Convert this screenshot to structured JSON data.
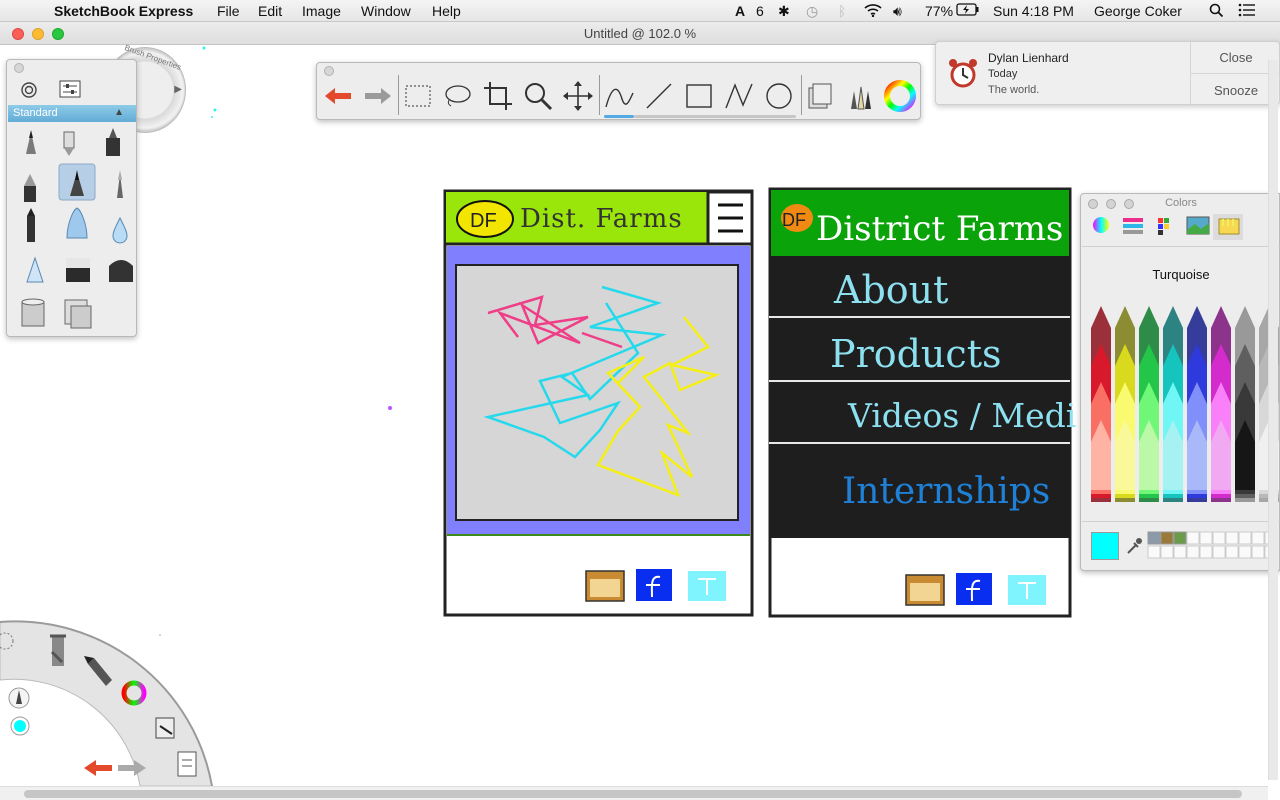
{
  "menubar": {
    "app_name": "SketchBook Express",
    "menus": [
      "File",
      "Edit",
      "Image",
      "Window",
      "Help"
    ],
    "adobe_count": "6",
    "battery": "77%",
    "clock": "Sun 4:18 PM",
    "user": "George Coker"
  },
  "window": {
    "title": "Untitled @ 102.0 %"
  },
  "brush_palette": {
    "preset": "Standard"
  },
  "notification": {
    "sender": "Dylan Lienhard",
    "time": "Today",
    "message": "The world.",
    "close_label": "Close",
    "snooze_label": "Snooze"
  },
  "colors_panel": {
    "title": "Colors",
    "color_name": "Turquoise",
    "selected_color": "#00ffff"
  },
  "brush_properties_label": "Brush Properties",
  "sketch_left": {
    "title": "Dist. Farms",
    "logo": "DF"
  },
  "sketch_right": {
    "title": "District Farms",
    "logo": "DF",
    "menu_items": [
      "About",
      "Products",
      "Videos / Media",
      "Internships"
    ]
  },
  "accent_colors": {
    "green": "#9be60a",
    "purple": "#8080ff",
    "turquoise": "#00ffff"
  }
}
